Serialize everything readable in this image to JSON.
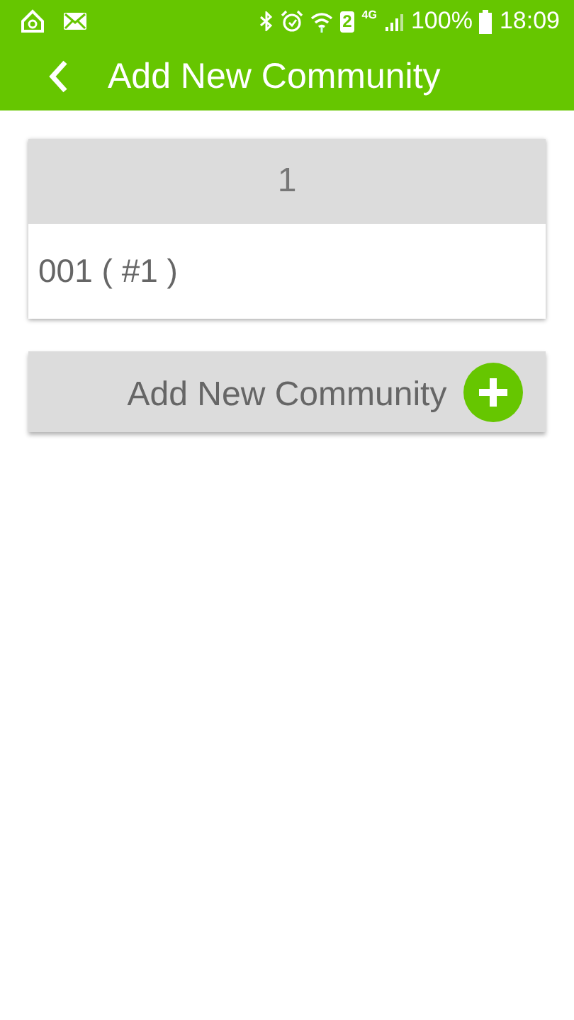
{
  "status_bar": {
    "sim": "2",
    "network": "4G",
    "battery": "100%",
    "time": "18:09"
  },
  "app_bar": {
    "title": "Add New Community"
  },
  "community_card": {
    "header": "1",
    "items": [
      "001 ( #1 )"
    ]
  },
  "add_button": {
    "label": "Add New Community"
  }
}
